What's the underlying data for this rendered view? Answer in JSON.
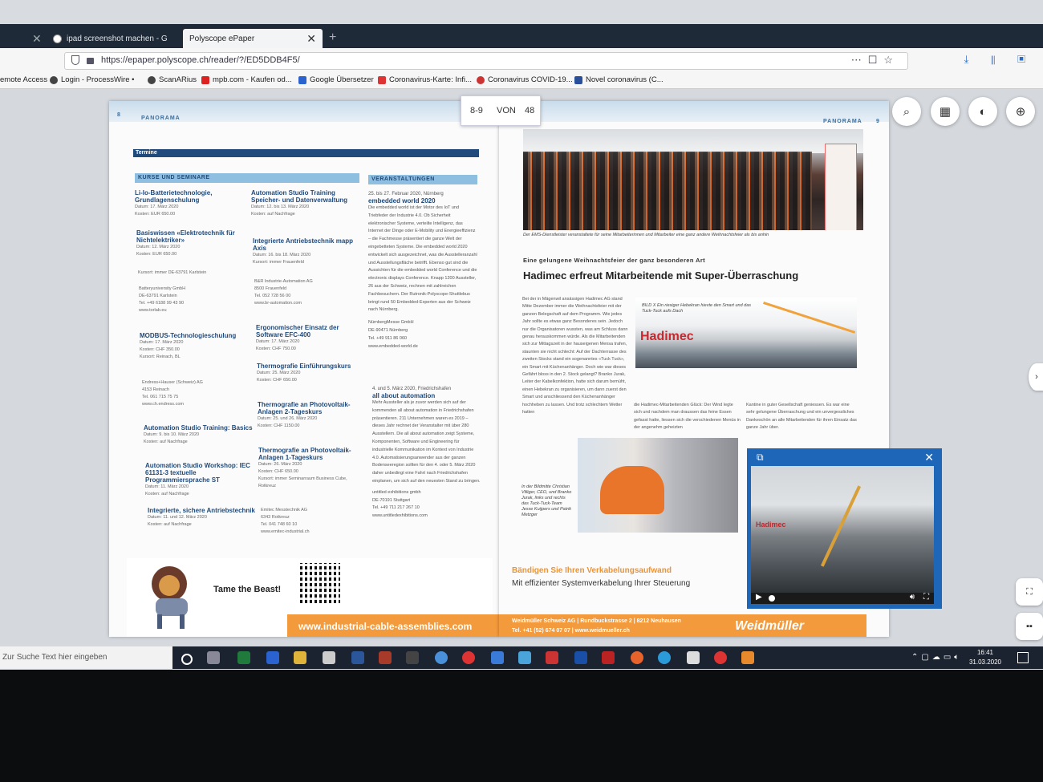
{
  "browser": {
    "tabs": [
      {
        "label": "ipad screenshot machen - G"
      },
      {
        "label": "Polyscope ePaper"
      }
    ],
    "url": "https://epaper.polyscope.ch/reader/?/ED5DDB4F5/",
    "bookmarks": [
      "emote Access",
      "Login - ProcessWire •",
      "ScanARius",
      "mpb.com - Kaufen od...",
      "Google Übersetzer",
      "Coronavirus-Karte: Infi...",
      "Coronavirus COVID-19...",
      "Novel coronavirus (C..."
    ]
  },
  "pager": {
    "current": "8-9",
    "von": "VON",
    "total": "48"
  },
  "left_page": {
    "number": "8",
    "section": "PANORAMA",
    "bar": "Termine",
    "kurse_header": "KURSE UND SEMINARE",
    "veranst_header": "VERANSTALTUNGEN",
    "col1": [
      {
        "title": "Li-Io-Batterietechnologie, Grundlagenschulung",
        "meta": "Datum: 17. März 2020\nKosten: EUR 650.00"
      },
      {
        "title": "Basiswissen «Elektrotechnik für Nichtelektriker»",
        "meta": "Datum: 12. März 2020\nKosten: EUR 650.00"
      },
      {
        "title": "MODBUS-Technologieschulung",
        "meta": "Datum: 17. März 2020\nKosten: CHF 350.00\nKursort: Reinach, BL"
      },
      {
        "title": "Automation Studio Training: Basics",
        "meta": "Datum: 9. bis 10. März 2020\nKosten: auf Nachfrage"
      },
      {
        "title": "Automation Studio Workshop: IEC 61131-3 textuelle Programmiersprache ST",
        "meta": "Datum: 11. März 2020\nKosten: auf Nachfrage"
      },
      {
        "title": "Integrierte, sichere Antriebstechnik",
        "meta": "Datum: 11. und 12. März 2020\nKosten: auf Nachfrage"
      }
    ],
    "col1_addr": [
      "Kursort: immer DE-63791 Karlstein",
      "Batteryuniversity GmbH\nDE-63791 Karlstein\nTel. +49 6188 99 43 90\nwww.torlab.eu",
      "Endress+Hauser (Schweiz) AG\n4153 Reinach\nTel. 061 715 75 75\nwww.ch.endress.com"
    ],
    "col2": [
      {
        "title": "Automation Studio Training Speicher- und Datenverwaltung",
        "meta": "Datum: 12. bis 13. März 2020\nKosten: auf Nachfrage"
      },
      {
        "title": "Integrierte Antriebstechnik mapp Axis",
        "meta": "Datum: 16. bis 18. März 2020\nKursort: immer Frauenfeld"
      },
      {
        "title": "Ergonomischer Einsatz der Software EFC-400",
        "meta": "Datum: 17. März 2020\nKosten: CHF 750.00"
      },
      {
        "title": "Thermografie Einführungskurs",
        "meta": "Datum: 25. März 2020\nKosten: CHF 650.00"
      },
      {
        "title": "Thermografie an Photovoltaik-Anlagen 2-Tageskurs",
        "meta": "Datum: 25. und 26. März 2020\nKosten: CHF 1150.00"
      },
      {
        "title": "Thermografie an Photovoltaik-Anlagen 1-Tageskurs",
        "meta": "Datum: 26. März 2020\nKosten: CHF 650.00\nKursort: immer Seminarraum Business Cube, Rotkreuz"
      }
    ],
    "col2_addr": [
      "B&R Industrie-Automation AG\n8500 Frauenfeld\nTel. 052 728 56 00\nwww.br-automation.com",
      "Emitec Messtechnik AG\n6343 Rotkreuz\nTel. 041 748 60 10\nwww.emitec-industrial.ch"
    ],
    "events": [
      {
        "date": "25. bis 27. Februar 2020, Nürnberg",
        "title": "embedded world 2020",
        "body": "Die embedded world ist der Motor des IoT und Triebfeder der Industrie 4.0. Ob Sicherheit elektronischer Systeme, verteilte Intelligenz, das Internet der Dinge oder E-Mobility und Energieeffizienz – die Fachmesse präsentiert die ganze Welt der eingebetteten Systeme. Die embedded world 2020 entwickelt sich ausgezeichnet, was die Ausstelleranzahl und Ausstellungsfläche betrifft. Ebenso gut sind die Aussichten für die embedded world Conference und die electronic displays Conference. Knapp 1200 Aussteller, 26 aus der Schweiz, rechnen mit zahlreichen Fachbesuchern. Der Rutronik-Polyscope-Shuttlebus bringt rund 50 Embedded-Experten aus der Schweiz nach Nürnberg.",
        "addr": "NürnbergMesse GmbH\nDE-90471 Nürnberg\nTel. +49 911 86 060\nwww.embedded-world.de"
      },
      {
        "date": "4. und 5. März 2020, Friedrichshafen",
        "title": "all about automation",
        "body": "Mehr Aussteller als je zuvor werden sich auf der kommenden all about automation in Friedrichshafen präsentieren. 211 Unternehmen waren es 2019 – dieses Jahr rechnet der Veranstalter mit über 280 Ausstellern. Die all about automation zeigt Systeme, Komponenten, Software und Engineering für industrielle Kommunikation im Kontext von Industrie 4.0. Automatisierungsanwender aus der ganzen Bodenseeregion sollten für den 4. oder 5. März 2020 daher unbedingt eine Fahrt nach Friedrichshafen einplanen, um sich auf den neuesten Stand zu bringen.",
        "addr": "untitled exhibitions gmbh\nDE-70191 Stuttgart\nTel. +49 711 217 267 10\nwww.untitledexhibitions.com"
      }
    ],
    "ad": {
      "slogan": "Tame the Beast!",
      "url": "www.industrial-cable-assemblies.com"
    }
  },
  "right_page": {
    "number": "9",
    "section": "PANORAMA",
    "photo_caption": "Der EMS-Dienstleister veranstaltete für seine Mitarbeiterinnen und Mitarbeiter eine ganz andere Weihnachtsfeier als bis anhin",
    "kicker": "Eine gelungene Weihnachtsfeier der ganz besonderen Art",
    "headline": "Hadimec erfreut Mitarbeitende mit Super-Überraschung",
    "body_col1": "Bei der in Mägenwil ansässigen Hadimec AG stand Mitte Dezember immer die Weihnachtsfeier mit der ganzen Belegschaft auf dem Programm. Wie jedes Jahr sollte es etwas ganz Besonderes sein. Jedoch nur die Organisatoren wussten, was am Schluss dann genau herauskommen würde. Als die Mitarbeitenden sich zur Mittagszeit in der hauseigenen Mensa trafen, staunten sie nicht schlecht: Auf der Dachterrasse des zweiten Stocks stand ein sogenanntes «Tuck Tuck», ein Smart mit Küchenanhänger. Doch wie war dieses Gefährt bloss in den 2. Stock gelangt? Branko Jurak, Leiter der Kabelkonfektion, hatte sich darum bemüht, einen Hebekran zu organisieren, um dann zuerst den Smart und anschliessend den Küchenanhänger hochheben zu lassen. Und trotz schlechtem Wetter hatten",
    "photo2_caption": "BILD X Ein riesiger Hebekran hievte den Smart und das Tuck-Tuck aufs Dach",
    "photo2_logo": "Hadimec",
    "body_col2": "die Hadimec-Mitarbeitenden Glück: Der Wind legte sich und nachdem man draussen das feine Essen gefasst hatte, liessen sich die verschiedenen Menüs in der angenehm geheizten",
    "body_col3": "Kantine in guter Gesellschaft geniessen. Es war eine sehr gelungene Überraschung und ein unvergessliches Dankeschön an alle Mitarbeitenden für ihren Einsatz das ganze Jahr über.",
    "photo3_caption": "In der Bildmitte Christian Villiger, CEO, und Branko Jurak, links und rechts das Tuck-Tuck-Team Jesse Kuijpers und Patrik Metzger",
    "ad": {
      "headline": "Bändigen Sie Ihren Verkabelungsaufwand",
      "sub": "Mit effizienter Systemverkabelung Ihrer Steuerung",
      "line1": "Weidmüller Schweiz AG | Rundbuckstrasse 2 | 8212 Neuhausen",
      "line2": "Tel. +41 (52) 674 07 07 | www.weidmueller.ch",
      "logo": "Weidmüller"
    }
  },
  "video": {
    "logo": "Hadimec"
  },
  "taskbar": {
    "search_placeholder": "Zur Suche Text hier eingeben",
    "time": "16:41",
    "date": "31.03.2020"
  }
}
